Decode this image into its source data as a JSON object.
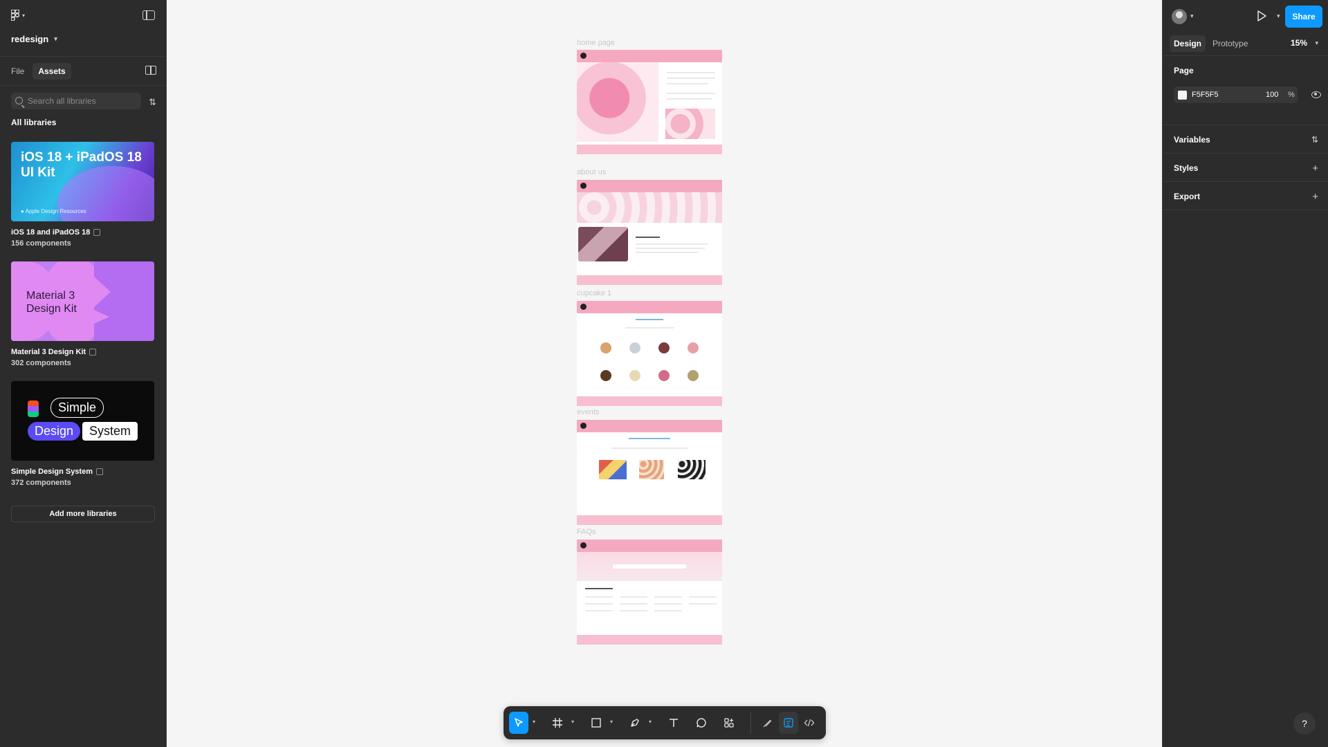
{
  "app": {
    "file_name": "redesign"
  },
  "left_panel": {
    "tabs": [
      {
        "label": "File"
      },
      {
        "label": "Assets"
      }
    ],
    "search": {
      "placeholder": "Search all libraries"
    },
    "section_title": "All libraries",
    "libraries": [
      {
        "name": "iOS 18 and iPadOS 18",
        "count": "156 components",
        "thumb_title": "iOS 18 + iPadOS 18\nUI Kit",
        "thumb_sub": "Apple Design Resources"
      },
      {
        "name": "Material 3 Design Kit",
        "count": "302 components",
        "thumb_title": "Material 3\nDesign Kit"
      },
      {
        "name": "Simple Design System",
        "count": "372 components",
        "thumb_words": [
          "Simple",
          "Design",
          "System"
        ]
      }
    ],
    "add_more_label": "Add more libraries"
  },
  "right_panel": {
    "share_label": "Share",
    "tabs": [
      {
        "label": "Design"
      },
      {
        "label": "Prototype"
      }
    ],
    "zoom": "15%",
    "page_section": {
      "title": "Page",
      "hex": "F5F5F5",
      "opacity": "100",
      "pct": "%"
    },
    "sections": [
      {
        "title": "Variables"
      },
      {
        "title": "Styles"
      },
      {
        "title": "Export"
      }
    ],
    "help": "?"
  },
  "canvas": {
    "frames": [
      {
        "label": "home page"
      },
      {
        "label": "about us"
      },
      {
        "label": "cupcake 1"
      },
      {
        "label": "events"
      },
      {
        "label": "FAQs"
      }
    ],
    "colors": {
      "header_pink": "#f5a9c1",
      "footer_pink": "#f7bfd0",
      "accent": "#0d99ff"
    }
  },
  "toolbar": {
    "tools": [
      "move-tool",
      "frame-tool",
      "shape-tool",
      "pen-tool",
      "text-tool",
      "comment-tool",
      "actions-tool",
      "draw-mode",
      "design-mode",
      "dev-mode"
    ]
  }
}
